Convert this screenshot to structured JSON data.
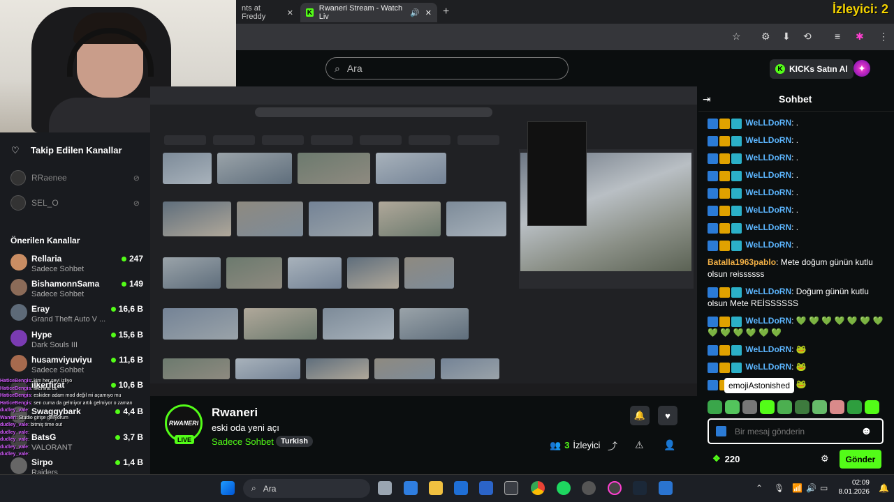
{
  "browser": {
    "tabs": [
      {
        "label": "nts at Freddy"
      },
      {
        "label": "Rwaneri Stream - Watch Liv"
      }
    ],
    "new_tab": "+"
  },
  "overlay": {
    "viewers": "İzleyici: 2"
  },
  "header": {
    "search_placeholder": "Ara",
    "kicks_button": "KICKs Satın Al"
  },
  "sidebar": {
    "followed_title": "Takip Edilen Kanallar",
    "followed": [
      {
        "name": "RRaenee"
      },
      {
        "name": "SEL_O"
      }
    ],
    "suggested_title": "Önerilen Kanallar",
    "suggested": [
      {
        "name": "Rellaria",
        "category": "Sadece Sohbet",
        "viewers": "247",
        "color": "#c98d63"
      },
      {
        "name": "BishamonnSama",
        "category": "Sadece Sohbet",
        "viewers": "149",
        "color": "#8b6b58"
      },
      {
        "name": "Eray",
        "category": "Grand Theft Auto V ...",
        "viewers": "16,6 B",
        "color": "#5d6a78"
      },
      {
        "name": "Hype",
        "category": "Dark Souls III",
        "viewers": "15,6 B",
        "color": "#7a3bb2"
      },
      {
        "name": "husamviyuviyu",
        "category": "Sadece Sohbet",
        "viewers": "11,6 B",
        "color": "#a66a4e"
      },
      {
        "name": "ilkerfirat",
        "category": "",
        "viewers": "10,6 B",
        "color": "#3a3a3a"
      },
      {
        "name": "Swaggybark",
        "category": "",
        "viewers": "4,4 B",
        "color": "#555"
      },
      {
        "name": "BatsG",
        "category": "VALORANT",
        "viewers": "3,7 B",
        "color": "#444"
      },
      {
        "name": "Sirpo",
        "category": "Raiders",
        "viewers": "1,4 B",
        "color": "#666"
      }
    ]
  },
  "obs_chat": [
    {
      "user": "HaticeBengis",
      "text": "kim her şeyi izliyo"
    },
    {
      "user": "HaticeBengis",
      "text": "ilkerfirat bu"
    },
    {
      "user": "HaticeBengis",
      "text": "eskiden adam mod değil mi açamıyo mu"
    },
    {
      "user": "HaticeBengis",
      "text": "sen cuma da gelmiyor artık gelmiyor o zaman"
    },
    {
      "user": "dudley_vale",
      "text": ""
    },
    {
      "user": "Waneri",
      "text": "Studio girişe geliyorum"
    },
    {
      "user": "dudley_vale",
      "text": "bitmiş time out"
    },
    {
      "user": "dudley_vale",
      "text": ""
    },
    {
      "user": "dudley_vale",
      "text": ""
    },
    {
      "user": "dudley_vale",
      "text": ""
    },
    {
      "user": "dudley_vale",
      "text": ""
    }
  ],
  "stream": {
    "channel": "Rwaneri",
    "avatar_text": "RWANERI",
    "live": "LIVE",
    "title": "eski oda yeni açı",
    "category": "Sadece Sohbet",
    "tag": "Turkish",
    "viewers": "3",
    "viewers_label": "İzleyici"
  },
  "chat": {
    "title": "Sohbet",
    "messages": [
      {
        "user": "WeLLDoRN",
        "text": ".",
        "badges": true
      },
      {
        "user": "WeLLDoRN",
        "text": ".",
        "badges": true
      },
      {
        "user": "WeLLDoRN",
        "text": ".",
        "badges": true
      },
      {
        "user": "WeLLDoRN",
        "text": ".",
        "badges": true
      },
      {
        "user": "WeLLDoRN",
        "text": ".",
        "badges": true
      },
      {
        "user": "WeLLDoRN",
        "text": ".",
        "badges": true
      },
      {
        "user": "WeLLDoRN",
        "text": ".",
        "badges": true
      },
      {
        "user": "WeLLDoRN",
        "text": ".",
        "badges": true
      },
      {
        "user": "Batalla1963pablo",
        "text": "Mete doğum günün kutlu olsun reissssss",
        "badges": false
      },
      {
        "user": "WeLLDoRN",
        "text": "Doğum günün kutlu olsun Mete REİSSSSSS",
        "badges": true
      },
      {
        "user": "WeLLDoRN",
        "text": "💚 💚 💚 💚 💚 💚 💚 💚 💚 💚 💚 💚 💚",
        "badges": true
      },
      {
        "user": "WeLLDoRN",
        "text": "🐸",
        "badges": true
      },
      {
        "user": "WeLLDoRN",
        "text": "🐸",
        "badges": true
      },
      {
        "user": "WeLLDoRN",
        "text": "🐸",
        "badges": true
      }
    ],
    "tooltip": "emojiAstonished",
    "input_placeholder": "Bir mesaj gönderin",
    "points": "220",
    "send": "Gönder"
  },
  "taskbar": {
    "search": "Ara",
    "time": "02:09",
    "date": "8.01.2026"
  }
}
